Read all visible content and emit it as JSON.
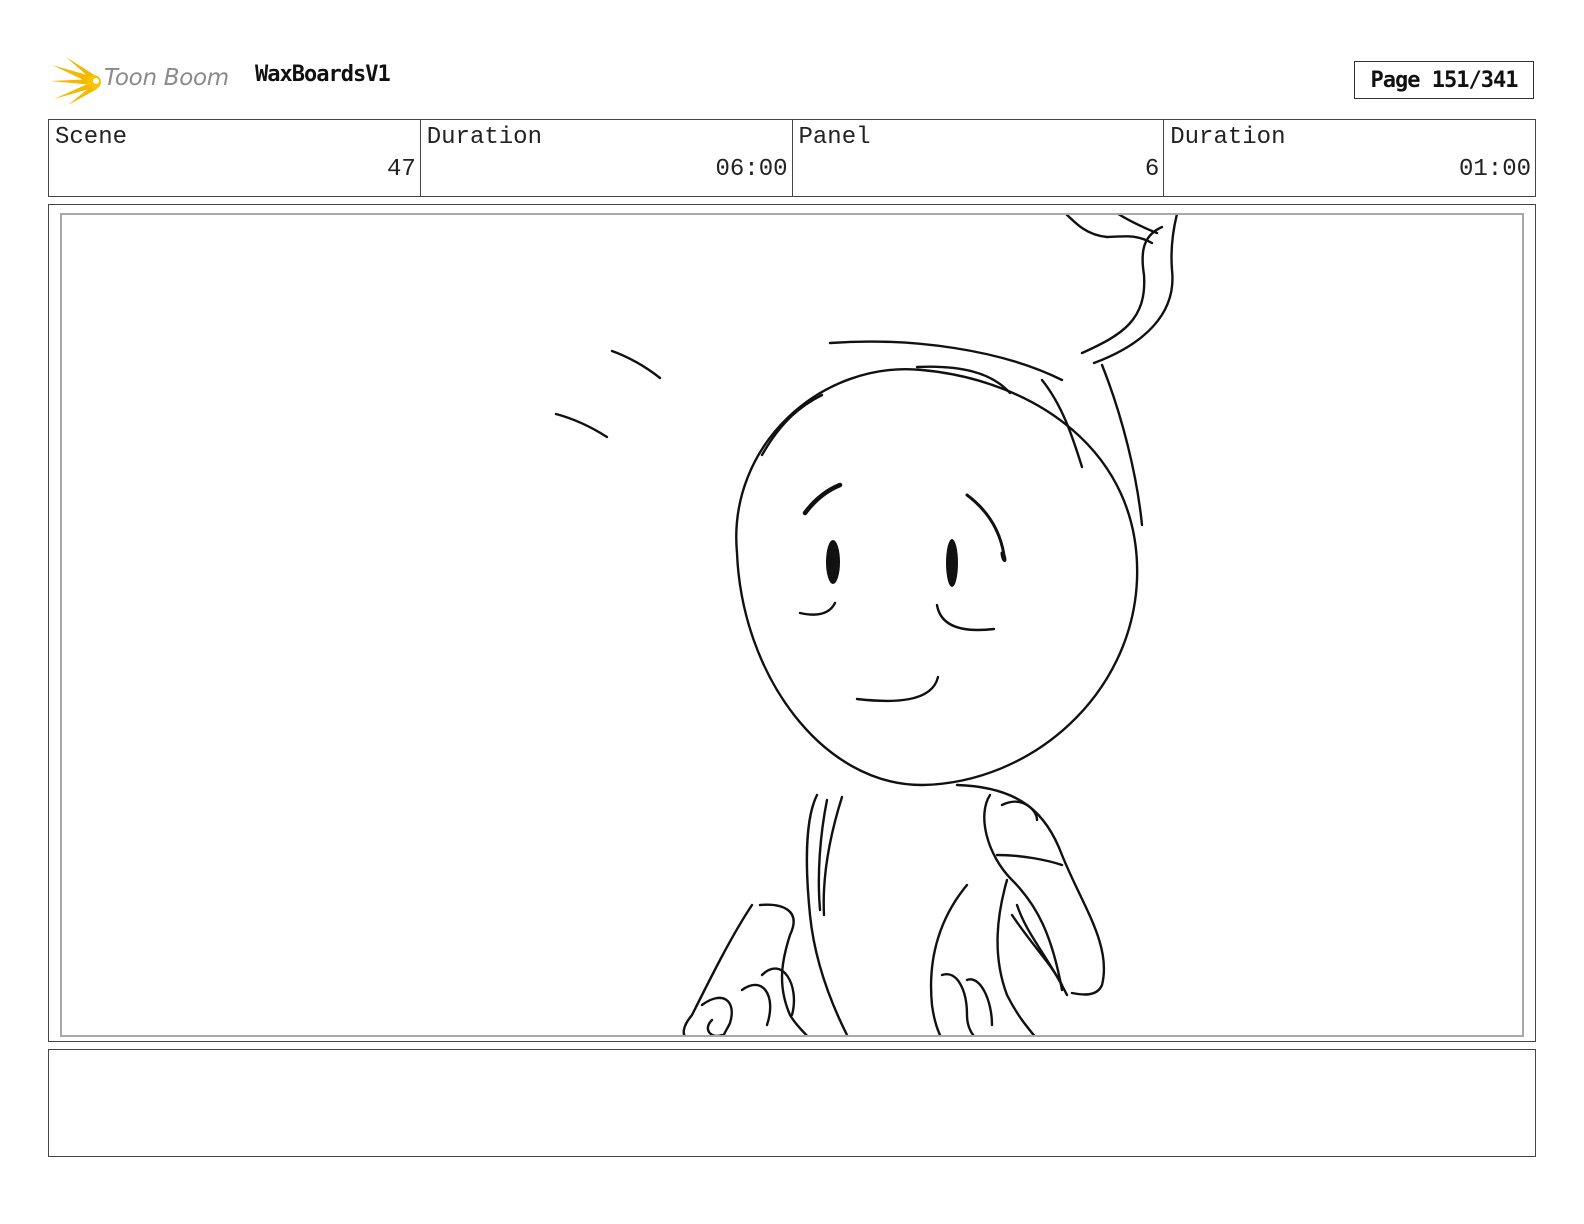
{
  "header": {
    "logo_text": "Toon Boom",
    "project_title": "WaxBoardsV1",
    "page_label": "Page 151/341"
  },
  "info": {
    "scene_label": "Scene",
    "scene_value": "47",
    "scene_duration_label": "Duration",
    "scene_duration_value": "06:00",
    "panel_label": "Panel",
    "panel_value": "6",
    "panel_duration_label": "Duration",
    "panel_duration_value": "01:00"
  },
  "notes": {
    "text": ""
  },
  "colors": {
    "logo_accent": "#f5b800",
    "logo_text": "#8a8a8a",
    "border": "#444444",
    "inner_frame": "#a8a8a8"
  }
}
